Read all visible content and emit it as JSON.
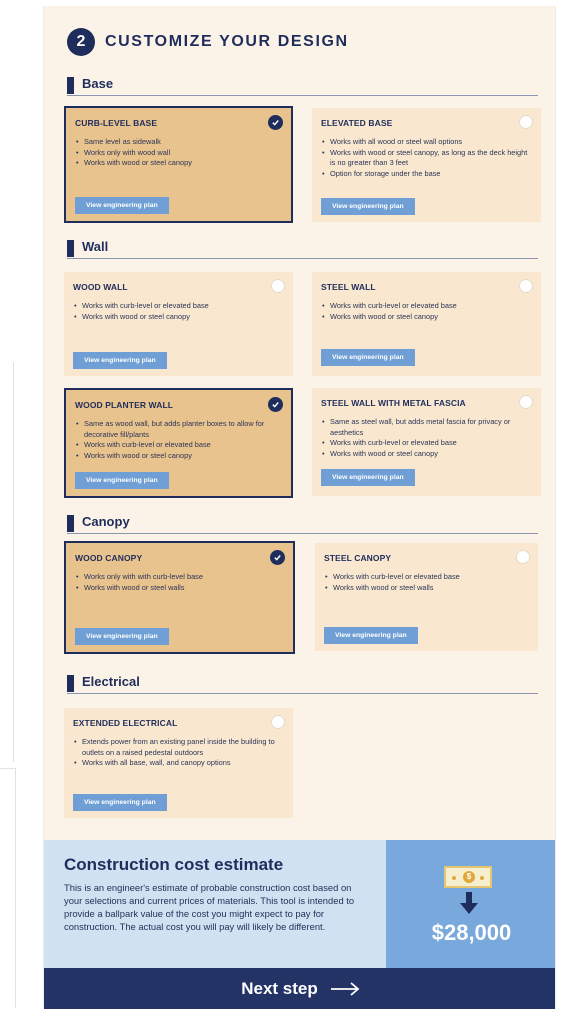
{
  "step": {
    "number": "2",
    "title": "CUSTOMIZE YOUR DESIGN"
  },
  "sections": {
    "base": "Base",
    "wall": "Wall",
    "canopy": "Canopy",
    "electrical": "Electrical"
  },
  "button_label": "View engineering plan",
  "cards": {
    "curb_level_base": {
      "title": "CURB-LEVEL BASE",
      "selected": true,
      "items": [
        "Same level as sidewalk",
        "Works only with wood wall",
        "Works with wood or steel canopy"
      ]
    },
    "elevated_base": {
      "title": "ELEVATED BASE",
      "selected": false,
      "items": [
        "Works with all wood or steel wall options",
        "Works with wood or steel canopy, as long as the deck height is no greater than 3 feet",
        "Option for storage under the base"
      ]
    },
    "wood_wall": {
      "title": "WOOD WALL",
      "selected": false,
      "items": [
        "Works with curb-level or elevated base",
        "Works with wood or steel canopy"
      ]
    },
    "steel_wall": {
      "title": "STEEL WALL",
      "selected": false,
      "items": [
        "Works with curb-level or elevated base",
        "Works with wood or steel canopy"
      ]
    },
    "wood_planter_wall": {
      "title": "WOOD PLANTER WALL",
      "selected": true,
      "items": [
        "Same as wood wall, but adds planter boxes to allow for decorative fill/plants",
        "Works with curb-level or elevated base",
        "Works with wood or steel canopy"
      ]
    },
    "steel_wall_metal_fascia": {
      "title": "STEEL WALL WITH METAL FASCIA",
      "selected": false,
      "items": [
        "Same as steel wall, but adds metal fascia for privacy or aesthetics",
        "Works with curb-level or elevated base",
        "Works with wood or steel canopy"
      ]
    },
    "wood_canopy": {
      "title": "WOOD CANOPY",
      "selected": true,
      "items": [
        "Works only with with curb-level base",
        "Works with wood or steel walls"
      ]
    },
    "steel_canopy": {
      "title": "STEEL CANOPY",
      "selected": false,
      "items": [
        "Works with curb-level or elevated base",
        "Works with wood or steel walls"
      ]
    },
    "extended_electrical": {
      "title": "EXTENDED ELECTRICAL",
      "selected": false,
      "items": [
        "Extends power from an existing panel inside the building to outlets on a raised pedestal outdoors",
        "Works with all base, wall, and canopy options"
      ]
    }
  },
  "cost": {
    "title": "Construction cost estimate",
    "text": "This is an engineer's estimate of probable construction cost based on your selections and current prices of materials. This tool is intended to provide a ballpark value of the cost you might expect to pay for construction. The actual cost you will pay will likely be different.",
    "price": "$28,000",
    "coin_symbol": "$"
  },
  "next_step": "Next step",
  "colors": {
    "navy": "#1f2d5c",
    "selected_card": "#e9c38d",
    "card": "#f9e8cf",
    "button": "#6f9fd4",
    "cost_bg": "#d0e2f2",
    "price_bg": "#79a9dc"
  }
}
